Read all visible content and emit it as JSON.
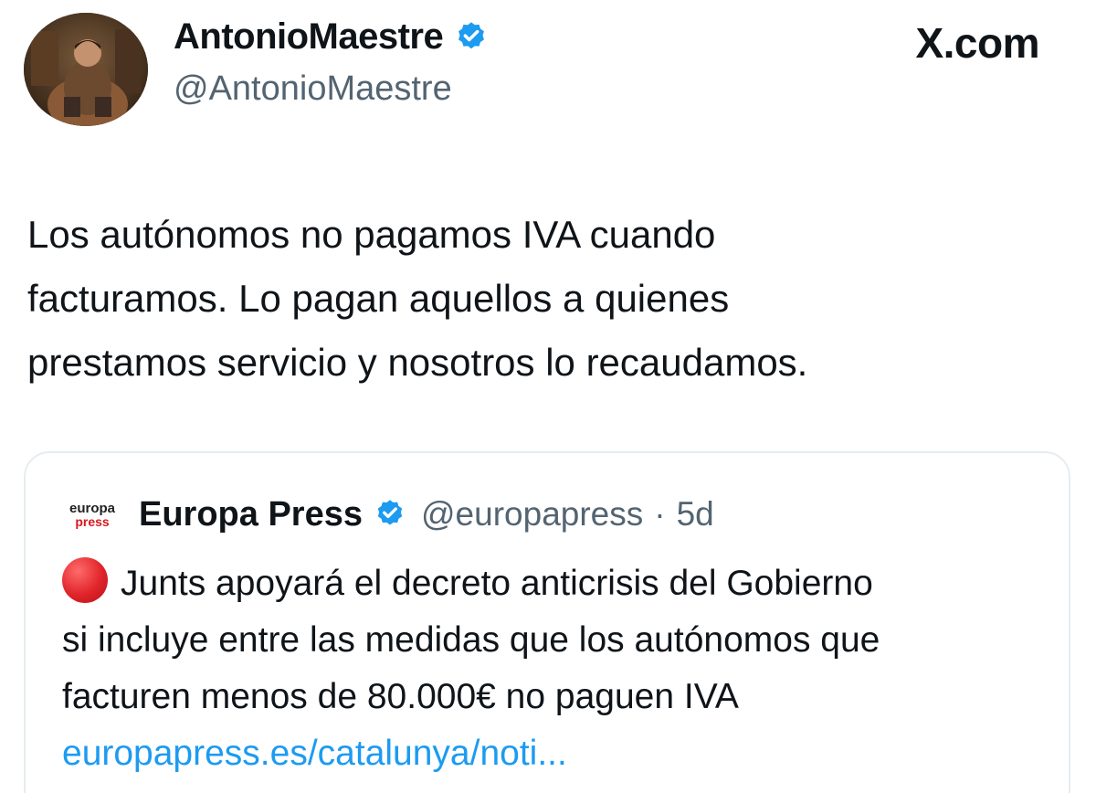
{
  "header": {
    "display_name": "AntonioMaestre",
    "handle": "@AntonioMaestre",
    "brand": "X.com",
    "verified": true
  },
  "tweet": {
    "lines": [
      "Los autónomos no pagamos IVA cuando",
      "facturamos. Lo pagan aquellos a quienes",
      "prestamos servicio y nosotros lo recaudamos."
    ]
  },
  "quote": {
    "logo_line1": "europa",
    "logo_line2": "press",
    "name": "Europa Press",
    "handle": "@europapress",
    "separator": "·",
    "time": "5d",
    "lines": [
      "Junts apoyará el decreto anticrisis del Gobierno",
      "si incluye entre las medidas que los autónomos que",
      "facturen menos de 80.000€ no paguen IVA"
    ],
    "link": "europapress.es/catalunya/noti..."
  },
  "colors": {
    "verified": "#1d9bf0",
    "link": "#1d9bf0",
    "secondary_text": "#536471",
    "alert": "#e0242a"
  }
}
